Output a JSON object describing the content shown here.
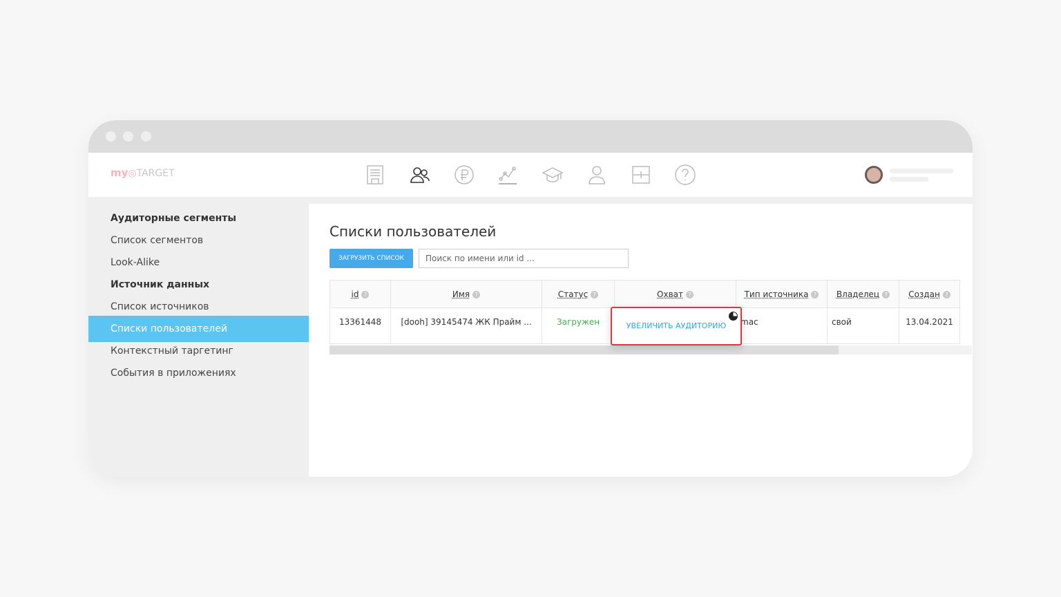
{
  "logo": {
    "my": "my",
    "target": "TARGET"
  },
  "nav_icons": [
    "document-icon",
    "audience-icon",
    "ruble-icon",
    "stats-icon",
    "education-icon",
    "profile-icon",
    "layout-icon",
    "help-icon"
  ],
  "sidebar": {
    "items": [
      {
        "label": "Аудиторные сегменты",
        "type": "heading"
      },
      {
        "label": "Список сегментов"
      },
      {
        "label": "Look-Alike"
      },
      {
        "label": "Источник данных",
        "type": "heading"
      },
      {
        "label": "Список источников"
      },
      {
        "label": "Списки пользователей",
        "active": true
      },
      {
        "label": "Контекстный таргетинг"
      },
      {
        "label": "События в приложениях"
      }
    ]
  },
  "main": {
    "title": "Списки пользователей",
    "upload_label": "ЗАГРУЗИТЬ СПИСОК",
    "search_placeholder": "Поиск по имени или id ...",
    "columns": [
      "id",
      "Имя",
      "Статус",
      "Охват",
      "Тип источника",
      "Владелец",
      "Создан"
    ],
    "rows": [
      {
        "id": "13361448",
        "name": "[dooh] 39145474 ЖК Прайм ...",
        "status": "Загружен",
        "reach": "",
        "type": "mac",
        "owner": "свой",
        "created": "13.04.2021"
      }
    ],
    "popup_label": "УВЕЛИЧИТЬ АУДИТОРИЮ",
    "status_color": "#3cb54a",
    "accent": "#45a9ea"
  }
}
